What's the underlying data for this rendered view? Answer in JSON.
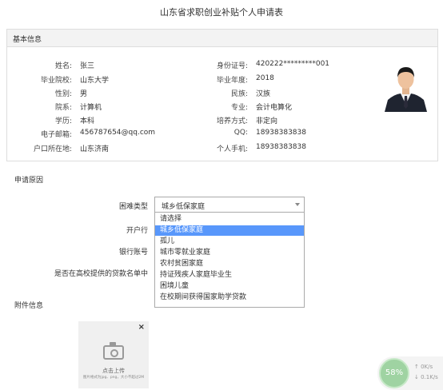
{
  "title": "山东省求职创业补贴个人申请表",
  "basic": {
    "header": "基本信息",
    "left": [
      {
        "label": "姓名:",
        "value": "张三"
      },
      {
        "label": "毕业院校:",
        "value": "山东大学"
      },
      {
        "label": "性别:",
        "value": "男"
      },
      {
        "label": "院系:",
        "value": "计算机"
      },
      {
        "label": "学历:",
        "value": "本科"
      },
      {
        "label": "电子邮箱:",
        "value": "456787654@qq.com"
      },
      {
        "label": "户口所在地:",
        "value": "山东济南"
      }
    ],
    "right": [
      {
        "label": "身份证号:",
        "value": "420222*********001"
      },
      {
        "label": "毕业年度:",
        "value": "2018"
      },
      {
        "label": "民族:",
        "value": "汉族"
      },
      {
        "label": "专业:",
        "value": "会计电算化"
      },
      {
        "label": "培养方式:",
        "value": "非定向"
      },
      {
        "label": "QQ:",
        "value": "18938383838"
      },
      {
        "label": "个人手机:",
        "value": "18938383838"
      }
    ]
  },
  "apply": {
    "header": "申请原因",
    "difficulty_label": "困难类型",
    "bank_label": "开户行",
    "account_label": "银行账号",
    "loan_label": "是否在高校提供的贷款名单中",
    "selected": "城乡低保家庭",
    "options": [
      "请选择",
      "城乡低保家庭",
      "孤儿",
      "城市零就业家庭",
      "农村贫困家庭",
      "持证残疾人家庭毕业生",
      "困境儿童",
      "在校期间获得国家助学贷款"
    ],
    "selected_index": 1
  },
  "attachment": {
    "header": "附件信息",
    "upload_label": "点击上传",
    "upload_hint": "图片格式为jpg、png，大小不超过2M",
    "close": "×"
  },
  "net": {
    "percent": "58%",
    "up": "0K/s",
    "down": "0.1K/s"
  },
  "colors": {
    "selected_option": "#5897fb"
  }
}
